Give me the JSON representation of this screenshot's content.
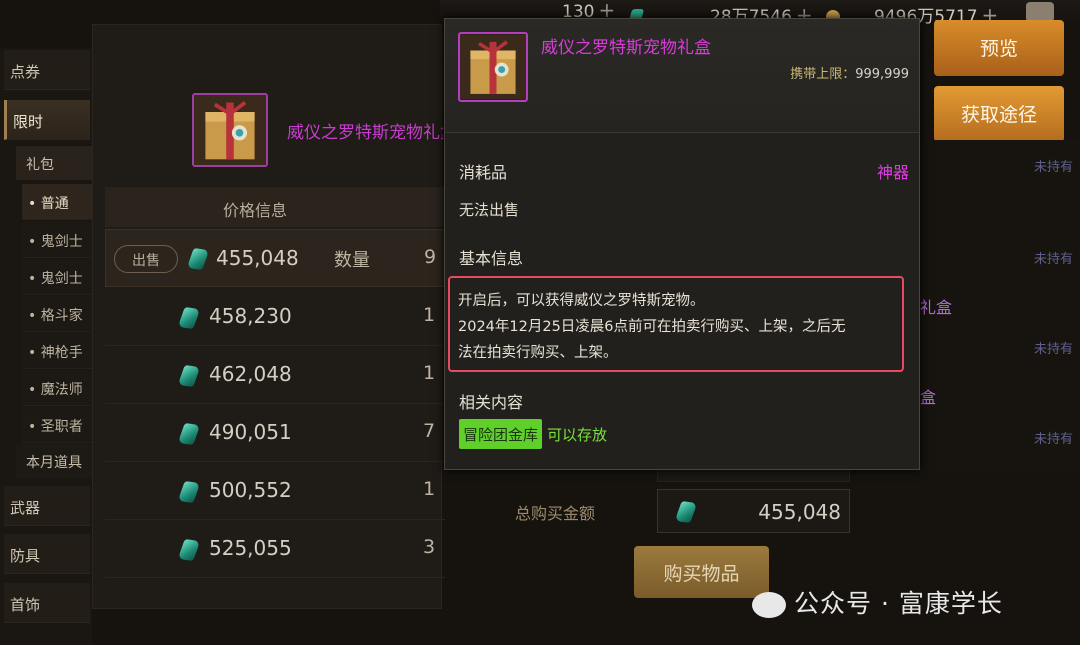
{
  "currency": [
    {
      "icon": "coin-icon",
      "value": "130"
    },
    {
      "icon": "crystal-icon",
      "value": "28万7546"
    },
    {
      "icon": "gold-coin-icon",
      "value": "9496万5717"
    }
  ],
  "sidebar": {
    "categories": [
      "点券",
      "限时",
      "武器",
      "防具",
      "首饰"
    ],
    "sub": [
      "礼包",
      "本月道具"
    ],
    "subsub": [
      "• 普通",
      "• 鬼剑士",
      "• 鬼剑士",
      "• 格斗家",
      "• 神枪手",
      "• 魔法师",
      "• 圣职者"
    ]
  },
  "listing": {
    "item_name": "威仪之罗特斯宠物礼盒",
    "price_header": "价格信息",
    "sell_label": "出售",
    "qty_label": "数量",
    "rows": [
      {
        "price": "455,048",
        "qty": "9"
      },
      {
        "price": "458,230",
        "qty": "1"
      },
      {
        "price": "462,048",
        "qty": "1"
      },
      {
        "price": "490,051",
        "qty": "7"
      },
      {
        "price": "500,552",
        "qty": "1"
      },
      {
        "price": "525,055",
        "qty": "3"
      }
    ]
  },
  "buttons": {
    "preview": "预览",
    "source": "获取途径",
    "buy": "购买物品"
  },
  "right_list": {
    "not_owned": "未持有",
    "gift_fragment": "礼盒",
    "gift_fragment2": "盒"
  },
  "purchase": {
    "total_label": "总购买金额",
    "total_value": "455,048"
  },
  "tooltip": {
    "name": "威仪之罗特斯宠物礼盒",
    "limit_label": "携带上限：",
    "limit_value": "999,999",
    "type": "消耗品",
    "rarity": "神器",
    "no_sell": "无法出售",
    "basic_info": "基本信息",
    "desc_line1": "开启后，可以获得威仪之罗特斯宠物。",
    "desc_line2": "2024年12月25日凌晨6点前可在拍卖行购买、上架，之后无",
    "desc_line3": "法在拍卖行购买、上架。",
    "related": "相关内容",
    "tag": "冒险团金库",
    "store": "可以存放"
  },
  "watermark": "公众号 · 富康学长",
  "colors": {
    "rarity": "#e13de6",
    "highlight": "#e84a63",
    "tag": "#5fcf2a",
    "button": "#d88c2a"
  }
}
